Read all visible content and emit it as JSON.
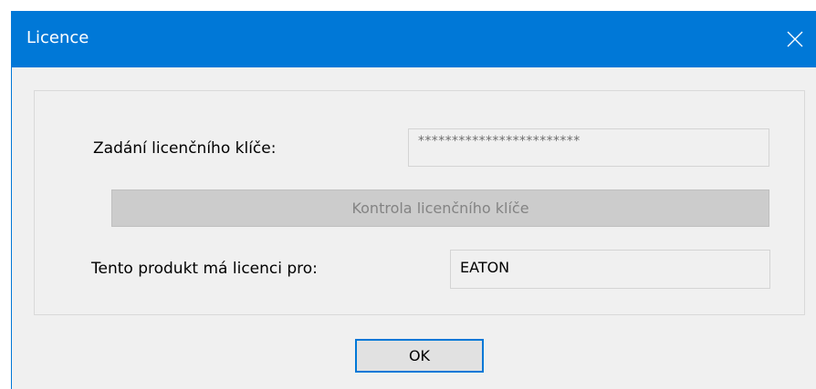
{
  "window": {
    "title": "Licence",
    "close_icon": "close-icon",
    "accent_color": "#0078d7"
  },
  "license_key": {
    "label": "Zadání licenčního klíče:",
    "masked_value": "************************"
  },
  "check_button": {
    "label": "Kontrola licenčního klíče",
    "enabled": false
  },
  "licensee": {
    "label": "Tento produkt má licenci pro:",
    "value": "EATON"
  },
  "ok_button": {
    "label": "OK"
  }
}
